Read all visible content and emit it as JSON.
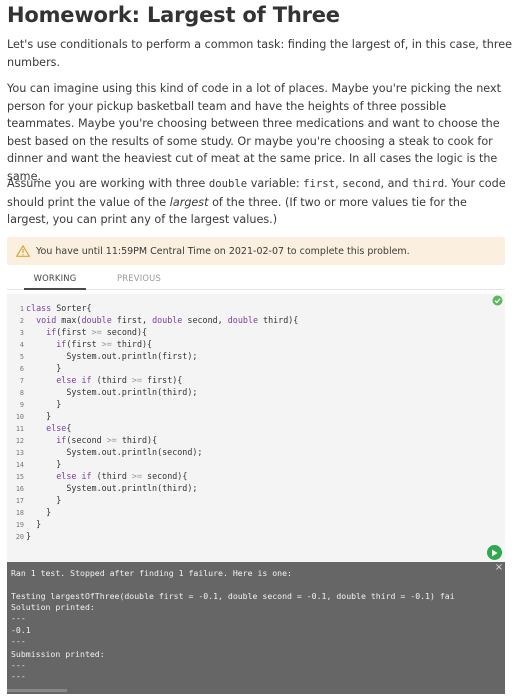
{
  "header": {
    "title": "Homework: Largest of Three"
  },
  "instructions": {
    "p1": "Let's use conditionals to perform a common task: finding the largest of, in this case, three numbers.",
    "p2": "You can imagine using this kind of code in a lot of places. Maybe you're picking the next person for your pickup basketball team and have the heights of three possible teammates. Maybe you're choosing between three medications and want to choose the best based on the results of some study. Or maybe you're choosing a steak to cook for dinner and want the heaviest cut of meat at the same price. In all cases the logic is the same.",
    "p3_a": "Assume you are working with three ",
    "p3_type": "double",
    "p3_b": " variable: ",
    "p3_first": "first",
    "p3_c": ", ",
    "p3_second": "second",
    "p3_d": ", and ",
    "p3_third": "third",
    "p3_e": ". Your code should print the value of the ",
    "p3_em": "largest",
    "p3_f": " of the three. (If two or more values tie for the largest, you can print any of the largest values.)"
  },
  "deadline": {
    "text": "You have until 11:59PM Central Time on 2021-02-07 to complete this problem."
  },
  "tabs": {
    "working": "WORKING",
    "previous": "PREVIOUS"
  },
  "editor": {
    "status_color": "#5cb85c",
    "lines": [
      {
        "n": "1",
        "segs": [
          [
            "kw",
            "class"
          ],
          [
            "t",
            " Sorter{"
          ]
        ]
      },
      {
        "n": "2",
        "segs": [
          [
            "t",
            "  "
          ],
          [
            "kw",
            "void"
          ],
          [
            "t",
            " max("
          ],
          [
            "kw",
            "double"
          ],
          [
            "t",
            " first, "
          ],
          [
            "kw",
            "double"
          ],
          [
            "t",
            " second, "
          ],
          [
            "kw",
            "double"
          ],
          [
            "t",
            " third){"
          ]
        ]
      },
      {
        "n": "3",
        "segs": [
          [
            "t",
            "    "
          ],
          [
            "kw",
            "if"
          ],
          [
            "t",
            "(first "
          ],
          [
            "op",
            ">="
          ],
          [
            "t",
            " second){"
          ]
        ]
      },
      {
        "n": "4",
        "segs": [
          [
            "t",
            "      "
          ],
          [
            "kw",
            "if"
          ],
          [
            "t",
            "(first "
          ],
          [
            "op",
            ">="
          ],
          [
            "t",
            " third){"
          ]
        ]
      },
      {
        "n": "5",
        "segs": [
          [
            "t",
            "        System.out.println(first);"
          ]
        ]
      },
      {
        "n": "6",
        "segs": [
          [
            "t",
            "      }"
          ]
        ]
      },
      {
        "n": "7",
        "segs": [
          [
            "t",
            "      "
          ],
          [
            "kw",
            "else if"
          ],
          [
            "t",
            " (third "
          ],
          [
            "op",
            ">="
          ],
          [
            "t",
            " first){"
          ]
        ]
      },
      {
        "n": "8",
        "segs": [
          [
            "t",
            "        System.out.println(third);"
          ]
        ]
      },
      {
        "n": "9",
        "segs": [
          [
            "t",
            "      }"
          ]
        ]
      },
      {
        "n": "10",
        "segs": [
          [
            "t",
            "    }"
          ]
        ]
      },
      {
        "n": "11",
        "segs": [
          [
            "t",
            "    "
          ],
          [
            "kw",
            "else"
          ],
          [
            "t",
            "{"
          ]
        ]
      },
      {
        "n": "12",
        "segs": [
          [
            "t",
            "      "
          ],
          [
            "kw",
            "if"
          ],
          [
            "t",
            "(second "
          ],
          [
            "op",
            ">="
          ],
          [
            "t",
            " third){"
          ]
        ]
      },
      {
        "n": "13",
        "segs": [
          [
            "t",
            "        System.out.println(second);"
          ]
        ]
      },
      {
        "n": "14",
        "segs": [
          [
            "t",
            "      }"
          ]
        ]
      },
      {
        "n": "15",
        "segs": [
          [
            "t",
            "      "
          ],
          [
            "kw",
            "else if"
          ],
          [
            "t",
            " (third "
          ],
          [
            "op",
            ">="
          ],
          [
            "t",
            " second){"
          ]
        ]
      },
      {
        "n": "16",
        "segs": [
          [
            "t",
            "        System.out.println(third);"
          ]
        ]
      },
      {
        "n": "17",
        "segs": [
          [
            "t",
            "      }"
          ]
        ]
      },
      {
        "n": "18",
        "segs": [
          [
            "t",
            "    }"
          ]
        ]
      },
      {
        "n": "19",
        "segs": [
          [
            "t",
            "  }"
          ]
        ]
      },
      {
        "n": "20",
        "segs": [
          [
            "t",
            "}"
          ]
        ]
      }
    ]
  },
  "output": {
    "lines": [
      "Ran 1 test. Stopped after finding 1 failure. Here is one:",
      "",
      "Testing largestOfThree(double first = -0.1, double second = -0.1, double third = -0.1) fai",
      "Solution printed:",
      "---",
      "-0.1",
      "---",
      "Submission printed:",
      "---",
      "---"
    ]
  },
  "buttons": {
    "run_color": "#2fa84f",
    "close_glyph": "×"
  }
}
